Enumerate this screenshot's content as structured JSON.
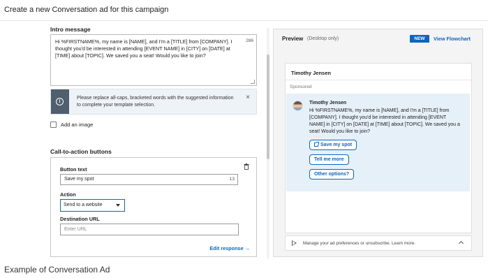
{
  "header": {
    "title": "Create a new Conversation ad for this campaign"
  },
  "editor": {
    "intro_label": "Intro message",
    "intro_text": "Hi %FIRSTNAME%, my name is [NAME], and I'm a [TITLE] from [COMPANY]. I thought you'd be interested in attending [EVENT NAME] in [CITY] on [DATE] at [TIME] about [TOPIC]. We saved you a seat! Would you like to join?",
    "intro_char_count": "286",
    "notice_text": "Please replace all-caps, bracketed words with the suggested information to complete your template selection.",
    "notice_close": "×",
    "add_image_label": "Add an image",
    "cta_heading": "Call-to-action buttons",
    "button_text_label": "Button text",
    "button_text_value": "Save my spot",
    "button_text_count": "13",
    "action_label": "Action",
    "action_value": "Send to a website",
    "destination_label": "Destination URL",
    "destination_placeholder": "Enter URL",
    "edit_response": "Edit response →"
  },
  "preview": {
    "title": "Preview",
    "subtitle": "(Desktop only)",
    "badge": "NEW",
    "view_flowchart": "View Flowchart",
    "sender_name": "Timothy Jensen",
    "sponsored": "Sponsored",
    "message_sender": "Timothy Jensen",
    "message_body": "Hi %FIRSTNAME%, my name is [NAME], and I'm a [TITLE] from [COMPANY]. I thought you'd be interested in attending [EVENT NAME] in [CITY] on [DATE] at [TIME] about [TOPIC]. We saved you a seat! Would you like to join?",
    "replies": [
      "Save my spot",
      "Tell me more",
      "Other options?"
    ],
    "manage_text": "Manage your ad preferences or unsubscribe. Learn more."
  },
  "caption": "Example of Conversation Ad",
  "colors": {
    "accent": "#0a66c2",
    "message_bg": "#e6f0f8",
    "notice_icon_bg": "#4f5f6e"
  },
  "icons": [
    "info-icon",
    "close-icon",
    "checkbox",
    "trash-icon",
    "chevron-down-icon",
    "external-link-icon",
    "play-icon",
    "chevron-up-icon",
    "avatar"
  ]
}
